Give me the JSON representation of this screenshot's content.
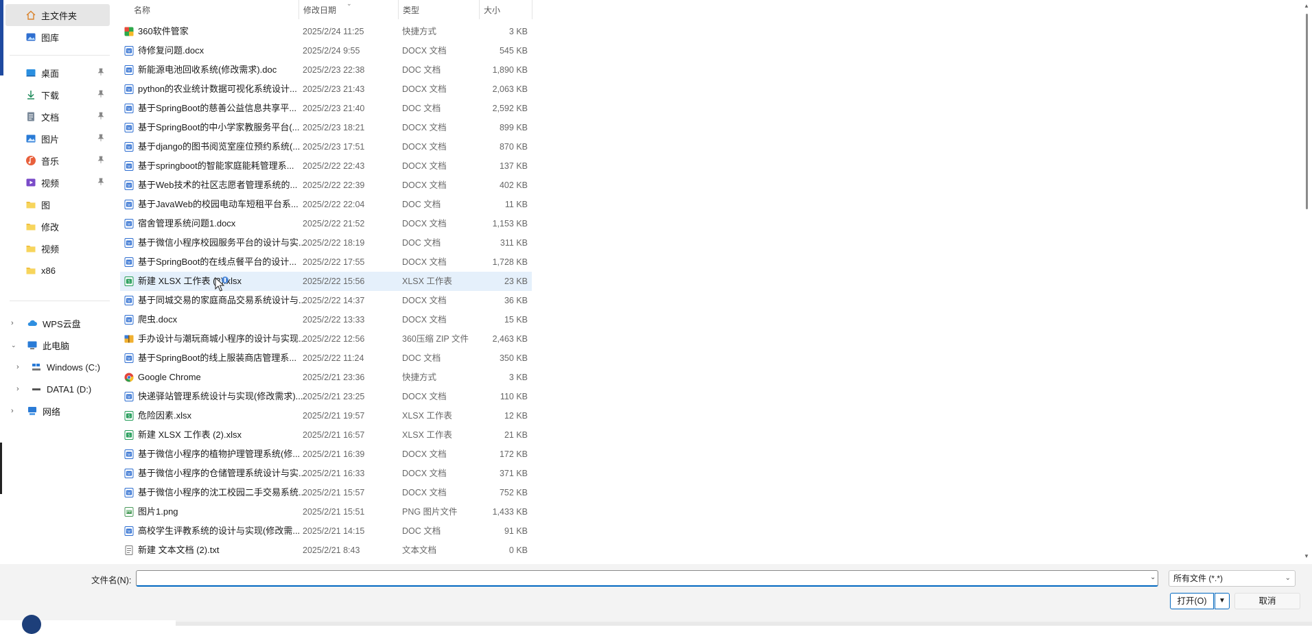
{
  "colors": {
    "accent": "#0067c0",
    "selected_row": "#e5f0fb"
  },
  "sidebar": {
    "home": {
      "label": "主文件夹",
      "icon": "home-icon"
    },
    "gallery": {
      "label": "图库",
      "icon": "gallery-icon"
    },
    "quick": [
      {
        "label": "桌面",
        "icon": "desktop-icon",
        "pinned": true
      },
      {
        "label": "下载",
        "icon": "download-icon",
        "pinned": true
      },
      {
        "label": "文档",
        "icon": "document-icon",
        "pinned": true
      },
      {
        "label": "图片",
        "icon": "pictures-icon",
        "pinned": true
      },
      {
        "label": "音乐",
        "icon": "music-icon",
        "pinned": true
      },
      {
        "label": "视频",
        "icon": "video-icon",
        "pinned": true
      },
      {
        "label": "图",
        "icon": "folder-icon"
      },
      {
        "label": "修改",
        "icon": "folder-icon"
      },
      {
        "label": "视频",
        "icon": "folder-icon"
      },
      {
        "label": "x86",
        "icon": "folder-icon"
      }
    ],
    "tree": {
      "wps": "WPS云盘",
      "pc": "此电脑",
      "c_drive": "Windows (C:)",
      "d_drive": "DATA1 (D:)",
      "network": "网络"
    }
  },
  "columns": {
    "name": "名称",
    "date": "修改日期",
    "type": "类型",
    "size": "大小"
  },
  "files": [
    {
      "name": "360软件管家",
      "date": "2025/2/24 11:25",
      "type": "快捷方式",
      "size": "3 KB",
      "icon": "app360"
    },
    {
      "name": "待修复问题.docx",
      "date": "2025/2/24 9:55",
      "type": "DOCX 文档",
      "size": "545 KB",
      "icon": "word"
    },
    {
      "name": "新能源电池回收系统(修改需求).doc",
      "date": "2025/2/23 22:38",
      "type": "DOC 文档",
      "size": "1,890 KB",
      "icon": "word"
    },
    {
      "name": "python的农业统计数据可视化系统设计...",
      "date": "2025/2/23 21:43",
      "type": "DOCX 文档",
      "size": "2,063 KB",
      "icon": "word"
    },
    {
      "name": "基于SpringBoot的慈善公益信息共享平...",
      "date": "2025/2/23 21:40",
      "type": "DOC 文档",
      "size": "2,592 KB",
      "icon": "word"
    },
    {
      "name": "基于SpringBoot的中小学家教服务平台(...",
      "date": "2025/2/23 18:21",
      "type": "DOCX 文档",
      "size": "899 KB",
      "icon": "word"
    },
    {
      "name": "基于django的图书阅览室座位预约系统(...",
      "date": "2025/2/23 17:51",
      "type": "DOCX 文档",
      "size": "870 KB",
      "icon": "word"
    },
    {
      "name": "基于springboot的智能家庭能耗管理系...",
      "date": "2025/2/22 22:43",
      "type": "DOCX 文档",
      "size": "137 KB",
      "icon": "word"
    },
    {
      "name": "基于Web技术的社区志愿者管理系统的...",
      "date": "2025/2/22 22:39",
      "type": "DOCX 文档",
      "size": "402 KB",
      "icon": "word"
    },
    {
      "name": "基于JavaWeb的校园电动车短租平台系...",
      "date": "2025/2/22 22:04",
      "type": "DOC 文档",
      "size": "11 KB",
      "icon": "word"
    },
    {
      "name": "宿舍管理系统问题1.docx",
      "date": "2025/2/22 21:52",
      "type": "DOCX 文档",
      "size": "1,153 KB",
      "icon": "word"
    },
    {
      "name": "基于微信小程序校园服务平台的设计与实...",
      "date": "2025/2/22 18:19",
      "type": "DOC 文档",
      "size": "311 KB",
      "icon": "word"
    },
    {
      "name": "基于SpringBoot的在线点餐平台的设计...",
      "date": "2025/2/22 17:55",
      "type": "DOCX 文档",
      "size": "1,728 KB",
      "icon": "word"
    },
    {
      "name": "新建 XLSX 工作表 (3).xlsx",
      "date": "2025/2/22 15:56",
      "type": "XLSX 工作表",
      "size": "23 KB",
      "icon": "excel",
      "highlight": true
    },
    {
      "name": "基于同城交易的家庭商品交易系统设计与...",
      "date": "2025/2/22 14:37",
      "type": "DOCX 文档",
      "size": "36 KB",
      "icon": "word"
    },
    {
      "name": "爬虫.docx",
      "date": "2025/2/22 13:33",
      "type": "DOCX 文档",
      "size": "15 KB",
      "icon": "word"
    },
    {
      "name": "手办设计与潮玩商城小程序的设计与实现...",
      "date": "2025/2/22 12:56",
      "type": "360压缩 ZIP 文件",
      "size": "2,463 KB",
      "icon": "zip"
    },
    {
      "name": "基于SpringBoot的线上服装商店管理系...",
      "date": "2025/2/22 11:24",
      "type": "DOC 文档",
      "size": "350 KB",
      "icon": "word"
    },
    {
      "name": "Google Chrome",
      "date": "2025/2/21 23:36",
      "type": "快捷方式",
      "size": "3 KB",
      "icon": "chrome"
    },
    {
      "name": "快递驿站管理系统设计与实现(修改需求)....",
      "date": "2025/2/21 23:25",
      "type": "DOCX 文档",
      "size": "110 KB",
      "icon": "word"
    },
    {
      "name": "危险因素.xlsx",
      "date": "2025/2/21 19:57",
      "type": "XLSX 工作表",
      "size": "12 KB",
      "icon": "excel"
    },
    {
      "name": "新建 XLSX 工作表 (2).xlsx",
      "date": "2025/2/21 16:57",
      "type": "XLSX 工作表",
      "size": "21 KB",
      "icon": "excel"
    },
    {
      "name": "基于微信小程序的植物护理管理系统(修...",
      "date": "2025/2/21 16:39",
      "type": "DOCX 文档",
      "size": "172 KB",
      "icon": "word"
    },
    {
      "name": "基于微信小程序的仓储管理系统设计与实...",
      "date": "2025/2/21 16:33",
      "type": "DOCX 文档",
      "size": "371 KB",
      "icon": "word"
    },
    {
      "name": "基于微信小程序的沈工校园二手交易系统...",
      "date": "2025/2/21 15:57",
      "type": "DOCX 文档",
      "size": "752 KB",
      "icon": "word"
    },
    {
      "name": "图片1.png",
      "date": "2025/2/21 15:51",
      "type": "PNG 图片文件",
      "size": "1,433 KB",
      "icon": "png"
    },
    {
      "name": "高校学生评教系统的设计与实现(修改需...",
      "date": "2025/2/21 14:15",
      "type": "DOC 文档",
      "size": "91 KB",
      "icon": "word"
    },
    {
      "name": "新建 文本文档 (2).txt",
      "date": "2025/2/21 8:43",
      "type": "文本文档",
      "size": "0 KB",
      "icon": "txt"
    }
  ],
  "footer": {
    "filename_label": "文件名(N):",
    "filename_value": "",
    "filetype": "所有文件 (*.*)",
    "open_label": "打开(O)",
    "cancel_label": "取消"
  }
}
